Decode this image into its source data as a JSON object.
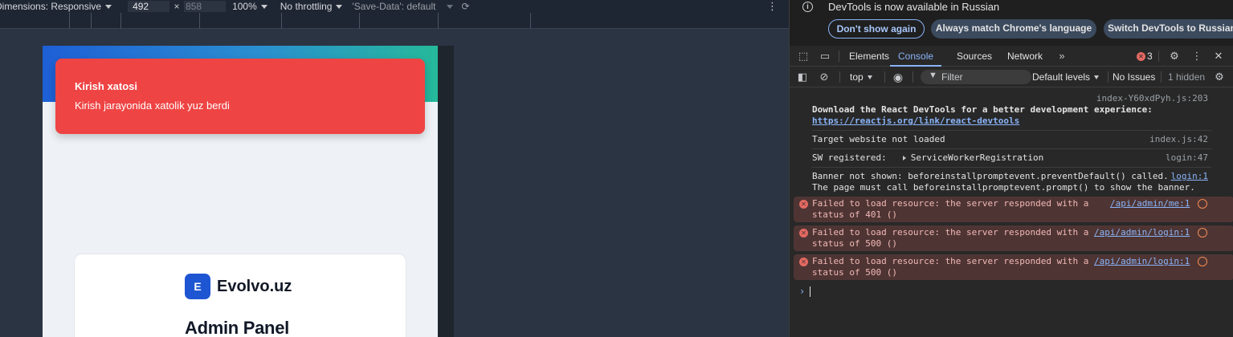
{
  "emulation": {
    "dimensions_label": "Dimensions: Responsive",
    "width": "492",
    "height": "858",
    "zoom": "100%",
    "throttling": "No throttling",
    "save_data": "'Save-Data': default"
  },
  "page": {
    "toast": {
      "title": "Kirish xatosi",
      "description": "Kirish jarayonida xatolik yuz berdi"
    },
    "brand": {
      "logo_letter": "E",
      "name": "Evolvo.uz"
    },
    "heading": "Admin Panel"
  },
  "devtools": {
    "infobar": {
      "text": "DevTools is now available in Russian",
      "buttons": [
        "Don't show again",
        "Always match Chrome's language",
        "Switch DevTools to Russian"
      ]
    },
    "tabs": [
      "Elements",
      "Console",
      "Sources",
      "Network"
    ],
    "active_tab": "Console",
    "error_count": "3",
    "toolbar": {
      "context": "top",
      "filter_placeholder": "Filter",
      "levels": "Default levels",
      "issues": "No Issues",
      "hidden": "1 hidden"
    },
    "console": {
      "react_source": "index-Y60xdPyh.js:203",
      "react_line1": "Download the React DevTools for a better development experience:",
      "react_link": "https://reactjs.org/link/react-devtools",
      "target_text": "Target website not loaded",
      "target_source": "index.js:42",
      "sw_text": "SW registered:",
      "sw_object": "ServiceWorkerRegistration",
      "sw_source": "login:47",
      "banner_line1": "Banner not shown: beforeinstallpromptevent.preventDefault() called.",
      "banner_source": "login:1",
      "banner_line2": "The page must call beforeinstallpromptevent.prompt() to show the banner.",
      "errors": [
        {
          "line1": "Failed to load resource: the server responded with a",
          "line2": "status of 401 ()",
          "link": "/api/admin/me:1"
        },
        {
          "line1": "Failed to load resource: the server responded with a",
          "line2": "status of 500 ()",
          "link": "/api/admin/login:1"
        },
        {
          "line1": "Failed to load resource: the server responded with a",
          "line2": "status of 500 ()",
          "link": "/api/admin/login:1"
        }
      ]
    }
  },
  "colors": {
    "toast_bg": "#ef4444",
    "brand_blue": "#1e55d2",
    "devtools_accent": "#8ab4f8",
    "error_row_bg": "#4e3534"
  },
  "icons": [
    "more-vertical-icon",
    "info-icon",
    "inspect-element-icon",
    "device-toggle-icon",
    "chevrons-right-icon",
    "error-icon",
    "gear-icon",
    "close-icon",
    "sidebar-icon",
    "clear-console-icon",
    "eye-icon",
    "filter-icon",
    "network-request-icon",
    "prompt-icon"
  ]
}
